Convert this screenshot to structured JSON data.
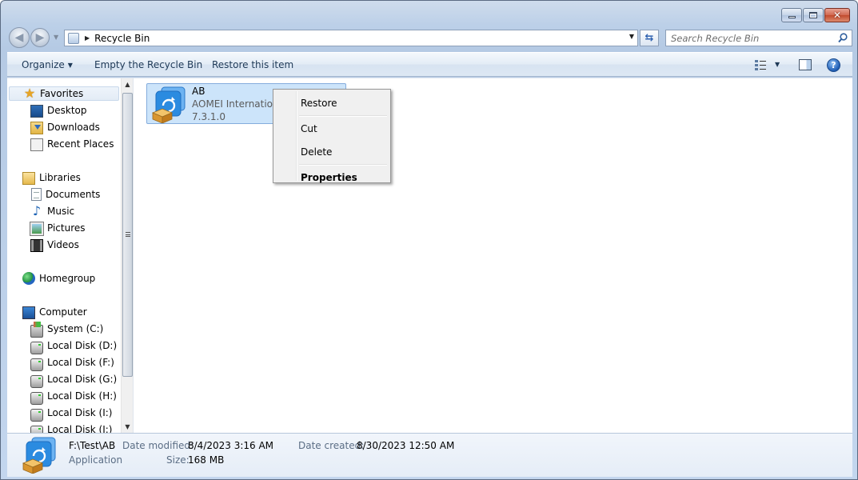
{
  "window": {
    "caption_buttons": [
      "minimize",
      "maximize",
      "close"
    ]
  },
  "address": {
    "location": "Recycle Bin"
  },
  "search": {
    "placeholder": "Search Recycle Bin"
  },
  "toolbar": {
    "organize_label": "Organize",
    "empty_label": "Empty the Recycle Bin",
    "restore_label": "Restore this item"
  },
  "navpane": {
    "favorites": "Favorites",
    "desktop": "Desktop",
    "downloads": "Downloads",
    "recent": "Recent Places",
    "libraries": "Libraries",
    "documents": "Documents",
    "music": "Music",
    "pictures": "Pictures",
    "videos": "Videos",
    "homegroup": "Homegroup",
    "computer": "Computer",
    "drive_c": "System (C:)",
    "drive_d": "Local Disk (D:)",
    "drive_f": "Local Disk (F:)",
    "drive_g": "Local Disk (G:)",
    "drive_h": "Local Disk (H:)",
    "drive_i": "Local Disk (I:)",
    "drive_j": "Local Disk (J:)"
  },
  "file": {
    "name": "AB",
    "publisher": "AOMEI International",
    "version": "7.3.1.0"
  },
  "context_menu": {
    "restore": "Restore",
    "cut": "Cut",
    "delete": "Delete",
    "properties": "Properties"
  },
  "details": {
    "path": "F:\\Test\\AB",
    "type": "Application",
    "date_modified_label": "Date modified:",
    "date_modified": "8/4/2023 3:16 AM",
    "size_label": "Size:",
    "size": "168 MB",
    "date_created_label": "Date created:",
    "date_created": "8/30/2023 12:50 AM"
  },
  "colors": {
    "selection": "#cce4fa",
    "selection_border": "#84acdd",
    "app_icon_blue": "#2b8be0"
  }
}
